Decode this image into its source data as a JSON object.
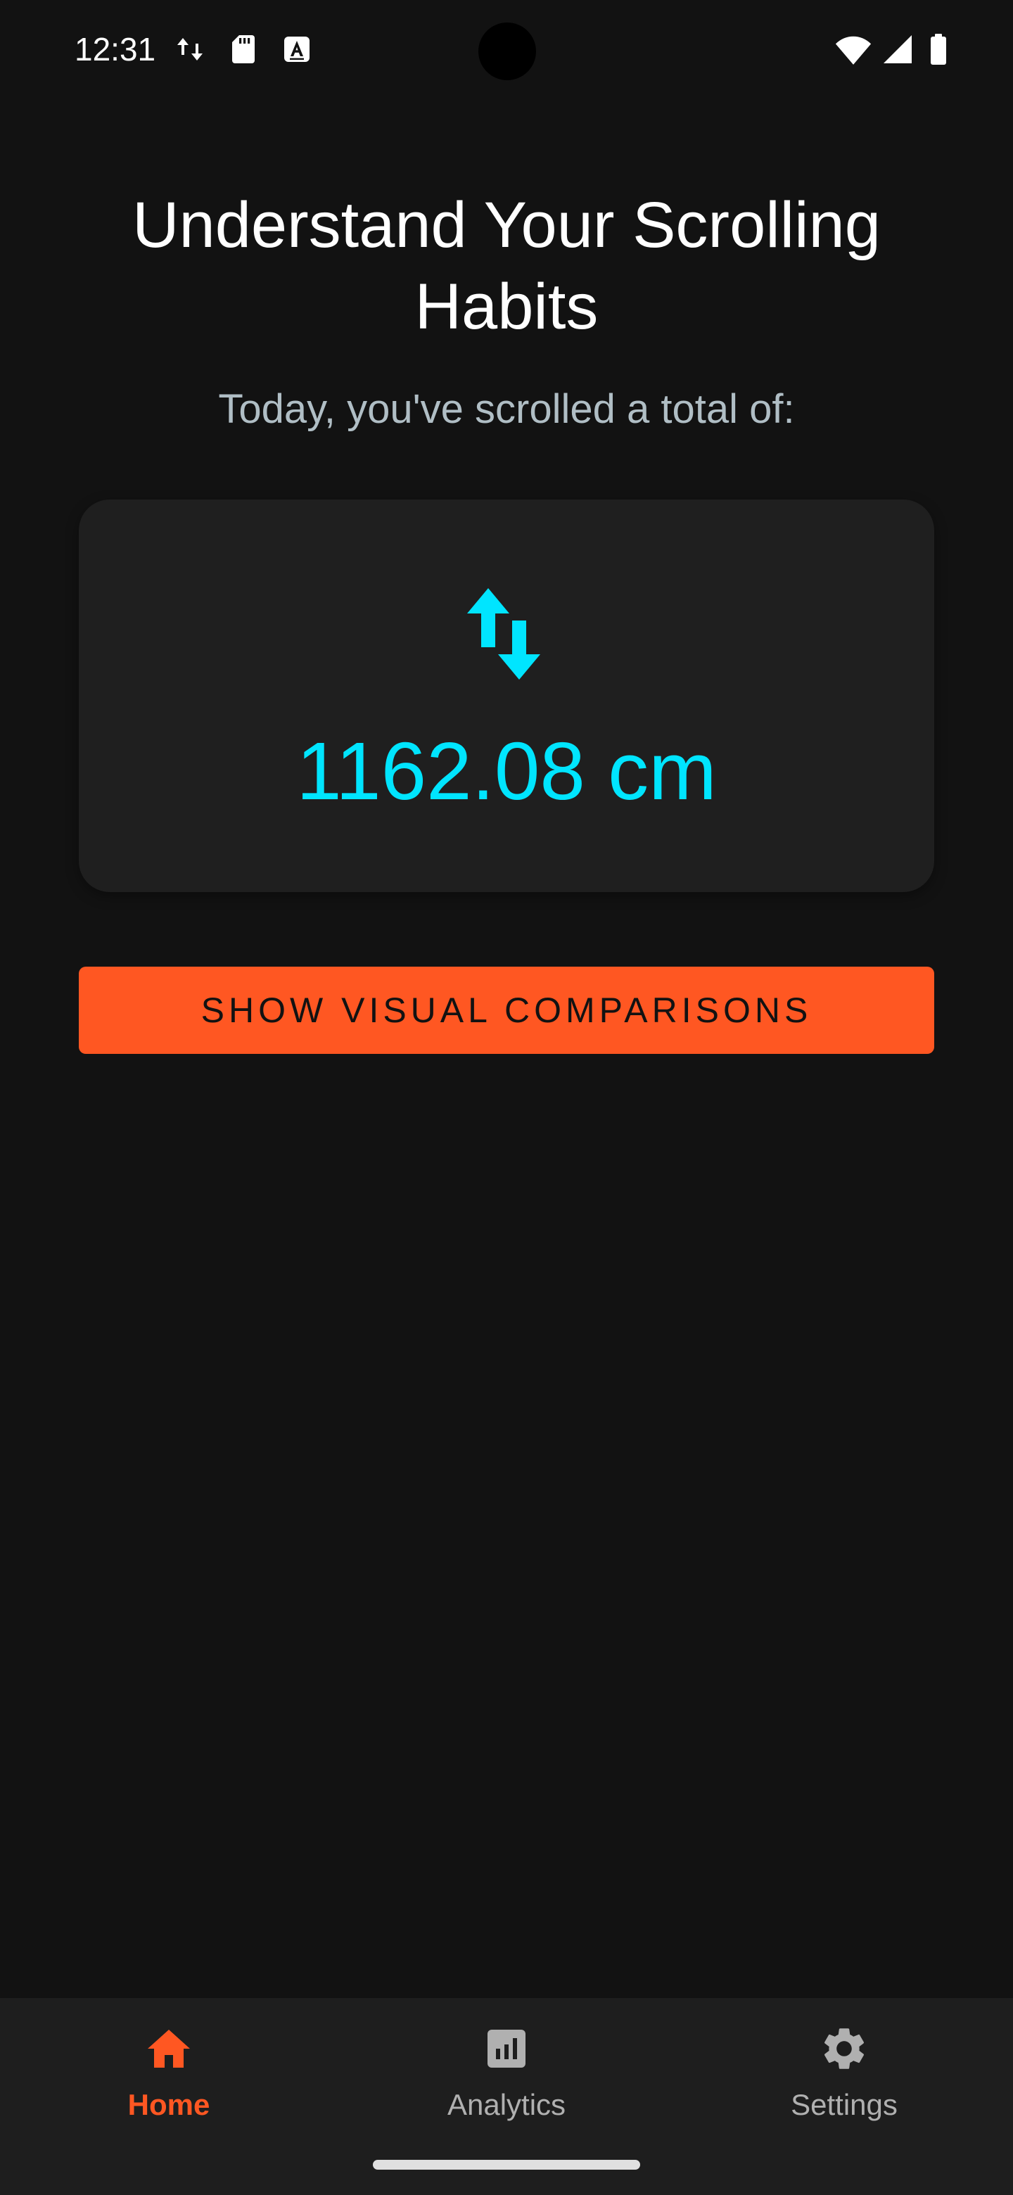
{
  "status_bar": {
    "time": "12:31",
    "icons": [
      "data-transfer-icon",
      "sd-card-icon",
      "font-badge-icon",
      "wifi-icon",
      "cellular-signal-icon",
      "battery-icon"
    ]
  },
  "header": {
    "title": "Understand Your Scrolling Habits",
    "subtitle": "Today, you've scrolled a total of:"
  },
  "card": {
    "icon": "swap-vertical-icon",
    "distance": "1162.08 cm"
  },
  "actions": {
    "comparisons_label": "SHOW VISUAL COMPARISONS"
  },
  "bottom_nav": {
    "items": [
      {
        "label": "Home",
        "icon": "home-icon",
        "active": true
      },
      {
        "label": "Analytics",
        "icon": "analytics-icon",
        "active": false
      },
      {
        "label": "Settings",
        "icon": "gear-icon",
        "active": false
      }
    ]
  },
  "colors": {
    "background": "#121212",
    "card": "#1f1f1f",
    "accent": "#ff5722",
    "highlight": "#00e5ff",
    "subtitle": "#b0bec5"
  }
}
